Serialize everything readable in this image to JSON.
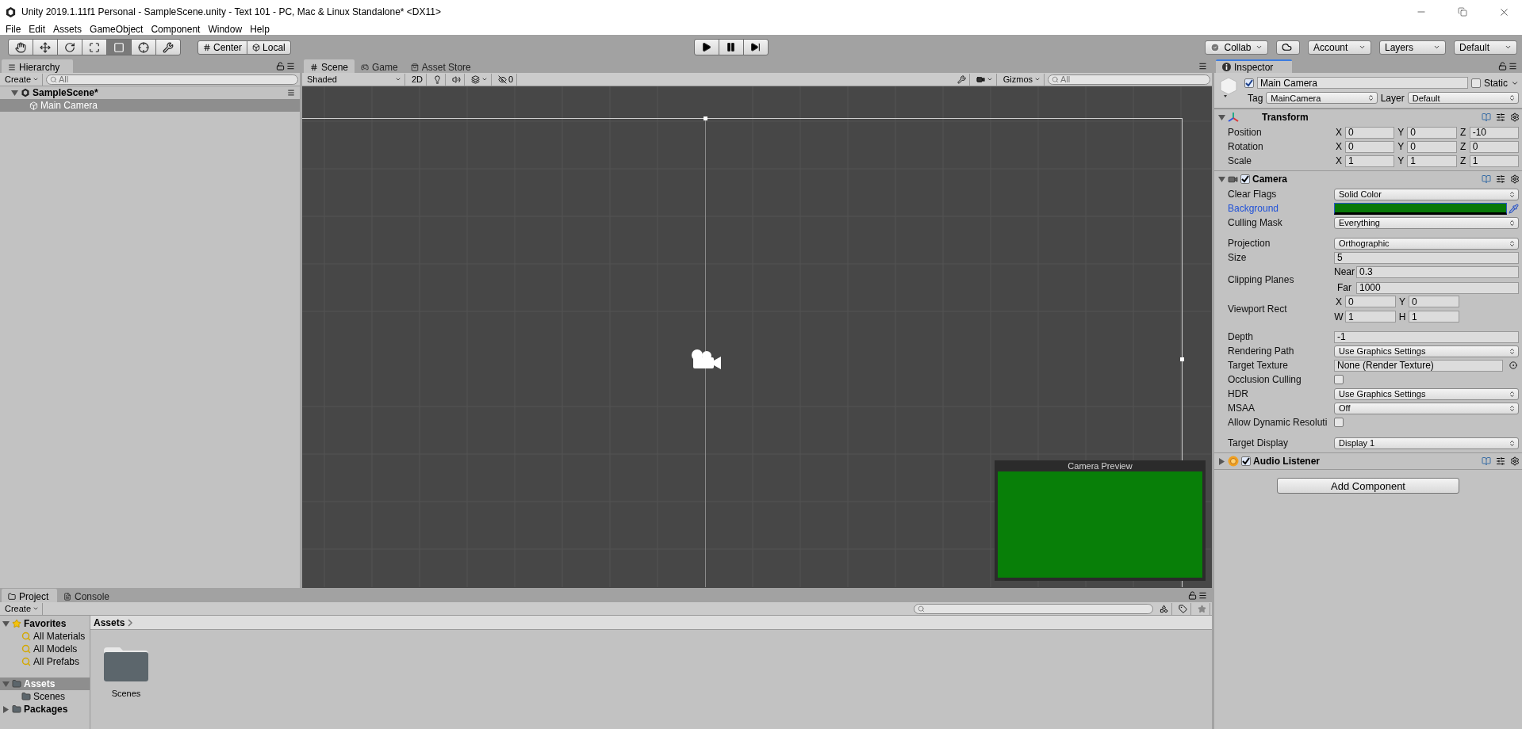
{
  "window": {
    "title": "Unity 2019.1.11f1 Personal - SampleScene.unity - Text 101 - PC, Mac & Linux Standalone* <DX11>"
  },
  "menu": [
    "File",
    "Edit",
    "Assets",
    "GameObject",
    "Component",
    "Window",
    "Help"
  ],
  "toolbar": {
    "tools": [
      {
        "kind": "hand",
        "selected": false
      },
      {
        "kind": "move",
        "selected": false
      },
      {
        "kind": "rotate",
        "selected": false
      },
      {
        "kind": "scale",
        "selected": false
      },
      {
        "kind": "rect",
        "selected": true
      },
      {
        "kind": "transform",
        "selected": false
      },
      {
        "kind": "custom",
        "selected": false
      }
    ],
    "pivot": [
      "Center",
      "Local"
    ],
    "play": [
      {
        "kind": "play"
      },
      {
        "kind": "pause"
      },
      {
        "kind": "step"
      }
    ],
    "right": [
      {
        "kind": "collab",
        "label": "Collab"
      },
      {
        "kind": "cloud"
      },
      {
        "kind": "dropdown",
        "label": "Account"
      },
      {
        "kind": "dropdown",
        "label": "Layers"
      },
      {
        "kind": "dropdown",
        "label": "Default"
      }
    ]
  },
  "hierarchy": {
    "tab": {
      "label": "Hierarchy",
      "focused": false
    },
    "create": "Create",
    "search_placeholder": "All",
    "scene": {
      "name": "SampleScene*",
      "expanded": true,
      "children": [
        {
          "name": "Main Camera",
          "selected": true
        }
      ]
    }
  },
  "scene_view": {
    "tabs": [
      {
        "label": "Scene",
        "kind": "scene",
        "selected": true
      },
      {
        "label": "Game",
        "kind": "game",
        "selected": false
      },
      {
        "label": "Asset Store",
        "kind": "store",
        "selected": false
      }
    ],
    "shading": "Shaded",
    "mode_2d": "2D",
    "hidden_count": "0",
    "gizmos": "Gizmos",
    "search_placeholder": "All",
    "preview": {
      "title": "Camera Preview"
    }
  },
  "inspector": {
    "tab": {
      "label": "Inspector",
      "focused": true
    },
    "object": {
      "active": true,
      "name": "Main Camera",
      "static": false,
      "static_label": "Static",
      "tag_label": "Tag",
      "tag": "MainCamera",
      "layer_label": "Layer",
      "layer": "Default"
    },
    "components": [
      {
        "kind": "transform",
        "title": "Transform",
        "expanded": true,
        "sections": [
          {
            "rows": [
              {
                "kind": "vector",
                "label": "Position",
                "values": [
                  {
                    "axis": "X",
                    "value": "0"
                  },
                  {
                    "axis": "Y",
                    "value": "0"
                  },
                  {
                    "axis": "Z",
                    "value": "-10"
                  }
                ]
              },
              {
                "kind": "vector",
                "label": "Rotation",
                "values": [
                  {
                    "axis": "X",
                    "value": "0"
                  },
                  {
                    "axis": "Y",
                    "value": "0"
                  },
                  {
                    "axis": "Z",
                    "value": "0"
                  }
                ]
              },
              {
                "kind": "vector",
                "label": "Scale",
                "values": [
                  {
                    "axis": "X",
                    "value": "1"
                  },
                  {
                    "axis": "Y",
                    "value": "1"
                  },
                  {
                    "axis": "Z",
                    "value": "1"
                  }
                ]
              }
            ]
          }
        ]
      },
      {
        "kind": "camera",
        "title": "Camera",
        "enabled": true,
        "expanded": true,
        "sections": [
          {
            "rows": [
              {
                "kind": "dropdown",
                "label": "Clear Flags",
                "value": "Solid Color",
                "focused": false
              },
              {
                "kind": "color",
                "label": "Background",
                "focused": true
              },
              {
                "kind": "dropdown",
                "label": "Culling Mask",
                "value": "Everything",
                "focused": false
              }
            ]
          },
          {
            "rows": [
              {
                "kind": "dropdown",
                "label": "Projection",
                "value": "Orthographic",
                "focused": false
              },
              {
                "kind": "field",
                "label": "Size",
                "value": "5",
                "focused": false
              },
              {
                "kind": "pair",
                "label": "Clipping Planes",
                "focused": false,
                "values": [
                  {
                    "axis": "Near",
                    "value": "0.3"
                  },
                  {
                    "axis": "Far",
                    "value": "1000"
                  }
                ]
              },
              {
                "kind": "rect",
                "label": "Viewport Rect",
                "focused": false,
                "values": [
                  {
                    "axis": "X",
                    "value": "0"
                  },
                  {
                    "axis": "Y",
                    "value": "0"
                  },
                  {
                    "axis": "W",
                    "value": "1"
                  },
                  {
                    "axis": "H",
                    "value": "1"
                  }
                ]
              }
            ]
          },
          {
            "rows": [
              {
                "kind": "field",
                "label": "Depth",
                "value": "-1",
                "focused": false
              },
              {
                "kind": "dropdown",
                "label": "Rendering Path",
                "value": "Use Graphics Settings",
                "focused": false
              },
              {
                "kind": "object",
                "label": "Target Texture",
                "value": "None (Render Texture)",
                "focused": false
              },
              {
                "kind": "checkbox",
                "label": "Occlusion Culling",
                "checked": false,
                "focused": false
              },
              {
                "kind": "dropdown",
                "label": "HDR",
                "value": "Use Graphics Settings",
                "focused": false
              },
              {
                "kind": "dropdown",
                "label": "MSAA",
                "value": "Off",
                "focused": false
              },
              {
                "kind": "checkbox",
                "label": "Allow Dynamic Resoluti",
                "checked": false,
                "focused": false
              }
            ]
          },
          {
            "rows": [
              {
                "kind": "dropdown",
                "label": "Target Display",
                "value": "Display 1",
                "focused": false
              }
            ]
          }
        ]
      },
      {
        "kind": "audio",
        "title": "Audio Listener",
        "enabled": true,
        "expanded": false
      }
    ],
    "add_component": "Add Component"
  },
  "project": {
    "tabs": [
      {
        "label": "Project",
        "kind": "project",
        "selected": true
      },
      {
        "label": "Console",
        "kind": "console",
        "selected": false
      }
    ],
    "create": "Create",
    "tree": [
      {
        "name": "Favorites",
        "kind": "favorites",
        "expanded": true,
        "selected": false,
        "children": [
          {
            "name": "All Materials",
            "kind": "search",
            "selected": false
          },
          {
            "name": "All Models",
            "kind": "search",
            "selected": false
          },
          {
            "name": "All Prefabs",
            "kind": "search",
            "selected": false
          }
        ]
      },
      {
        "name": "Assets",
        "kind": "folder",
        "expanded": true,
        "selected": true,
        "children": [
          {
            "name": "Scenes",
            "kind": "folder",
            "selected": false
          }
        ]
      },
      {
        "name": "Packages",
        "kind": "folder",
        "expanded": false,
        "selected": false
      }
    ],
    "breadcrumb": "Assets",
    "items": [
      {
        "name": "Scenes",
        "kind": "folder"
      }
    ]
  }
}
